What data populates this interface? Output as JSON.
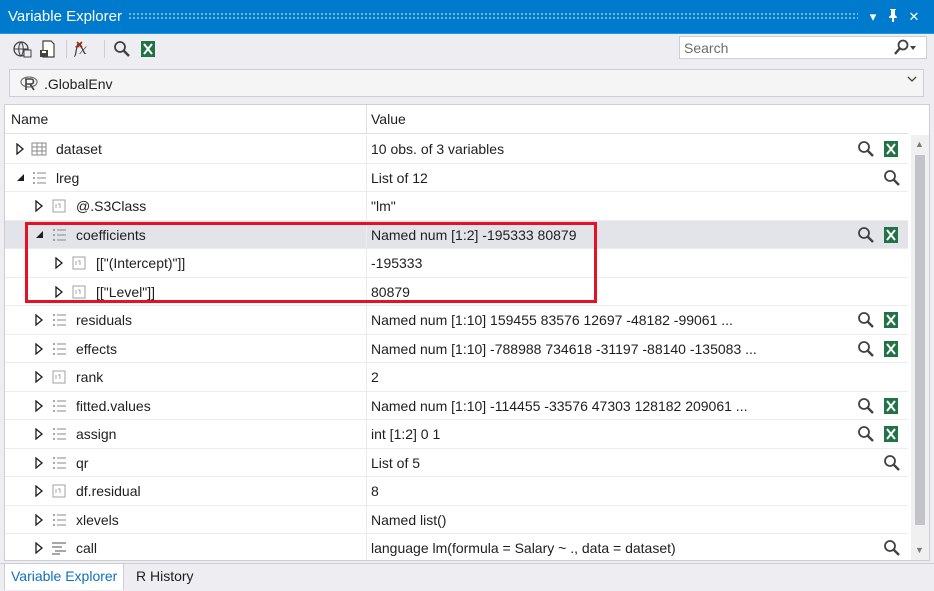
{
  "window": {
    "title": "Variable Explorer"
  },
  "toolbar": {
    "icons": [
      "load-workspace-icon",
      "save-workspace-icon",
      "delete-all-icon",
      "search-icon",
      "excel-icon"
    ],
    "search_placeholder": "Search"
  },
  "environment": {
    "selected": ".GlobalEnv"
  },
  "columns": {
    "name": "Name",
    "value": "Value"
  },
  "rows": [
    {
      "name": "dataset",
      "value": "10 obs. of  3 variables",
      "level": 0,
      "expander": "collapsed",
      "type_icon": "table-icon",
      "actions": [
        "search-icon",
        "excel-icon"
      ]
    },
    {
      "name": "lreg",
      "value": "List of 12",
      "level": 0,
      "expander": "expanded",
      "type_icon": "list-icon",
      "actions": [
        "search-icon"
      ]
    },
    {
      "name": "@.S3Class",
      "value": "\"lm\"",
      "level": 1,
      "expander": "collapsed",
      "type_icon": "vector-icon",
      "actions": []
    },
    {
      "name": "coefficients",
      "value": "Named num [1:2] -195333 80879",
      "level": 1,
      "expander": "expanded",
      "type_icon": "list-icon",
      "actions": [
        "search-icon",
        "excel-icon"
      ],
      "selected": true
    },
    {
      "name": "[[\"(Intercept)\"]]",
      "value": "-195333",
      "level": 2,
      "expander": "collapsed",
      "type_icon": "vector-icon",
      "actions": []
    },
    {
      "name": "[[\"Level\"]]",
      "value": "80879",
      "level": 2,
      "expander": "collapsed",
      "type_icon": "vector-icon",
      "actions": []
    },
    {
      "name": "residuals",
      "value": "Named num [1:10] 159455 83576 12697 -48182 -99061 ...",
      "level": 1,
      "expander": "collapsed",
      "type_icon": "list-icon",
      "actions": [
        "search-icon",
        "excel-icon"
      ]
    },
    {
      "name": "effects",
      "value": "Named num [1:10] -788988 734618 -31197 -88140 -135083 ...",
      "level": 1,
      "expander": "collapsed",
      "type_icon": "list-icon",
      "actions": [
        "search-icon",
        "excel-icon"
      ]
    },
    {
      "name": "rank",
      "value": "2",
      "level": 1,
      "expander": "collapsed",
      "type_icon": "vector-icon",
      "actions": []
    },
    {
      "name": "fitted.values",
      "value": "Named num [1:10] -114455 -33576 47303 128182 209061 ...",
      "level": 1,
      "expander": "collapsed",
      "type_icon": "list-icon",
      "actions": [
        "search-icon",
        "excel-icon"
      ]
    },
    {
      "name": "assign",
      "value": "int [1:2] 0 1",
      "level": 1,
      "expander": "collapsed",
      "type_icon": "list-icon",
      "actions": [
        "search-icon",
        "excel-icon"
      ]
    },
    {
      "name": "qr",
      "value": "List of 5",
      "level": 1,
      "expander": "collapsed",
      "type_icon": "list-icon",
      "actions": [
        "search-icon"
      ]
    },
    {
      "name": "df.residual",
      "value": "8",
      "level": 1,
      "expander": "collapsed",
      "type_icon": "vector-icon",
      "actions": []
    },
    {
      "name": "xlevels",
      "value": "Named list()",
      "level": 1,
      "expander": "collapsed",
      "type_icon": "list-icon",
      "actions": []
    },
    {
      "name": "call",
      "value": "language lm(formula = Salary ~ ., data = dataset)",
      "level": 1,
      "expander": "collapsed",
      "type_icon": "language-icon",
      "actions": [
        "search-icon"
      ]
    }
  ],
  "tabs": [
    {
      "label": "Variable Explorer",
      "active": true
    },
    {
      "label": "R History",
      "active": false
    }
  ],
  "colors": {
    "title_bar": "#007acc",
    "excel_green": "#217346",
    "highlight_border": "#e81123",
    "selected_row": "#e2e4ea"
  }
}
